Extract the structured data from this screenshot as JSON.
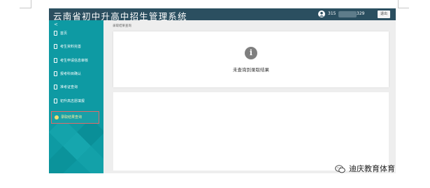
{
  "header": {
    "app_title": "云南省初中升高中招生管理系统",
    "phone_prefix": "315",
    "phone_suffix": "329",
    "logout_label": "退出"
  },
  "sidebar": {
    "collapse_symbol": "<",
    "items": [
      {
        "label": "首页"
      },
      {
        "label": "考生资料完善"
      },
      {
        "label": "考生申请信息审核"
      },
      {
        "label": "报考科目确认"
      },
      {
        "label": "准考证查询"
      },
      {
        "label": "初升高志愿填报"
      },
      {
        "label": "录取结果查询",
        "active": true
      }
    ]
  },
  "breadcrumb": "录取结果查询",
  "result_card": {
    "icon": "info-icon",
    "message": "未查询到录取结果"
  },
  "watermark": {
    "icon": "wechat-icon",
    "text": "迪庆教育体育"
  },
  "colors": {
    "header": "#2b4f60",
    "sidebar": "#0e9aa3",
    "active_text": "#fbf1a0",
    "highlight_box": "#e06a6a"
  }
}
